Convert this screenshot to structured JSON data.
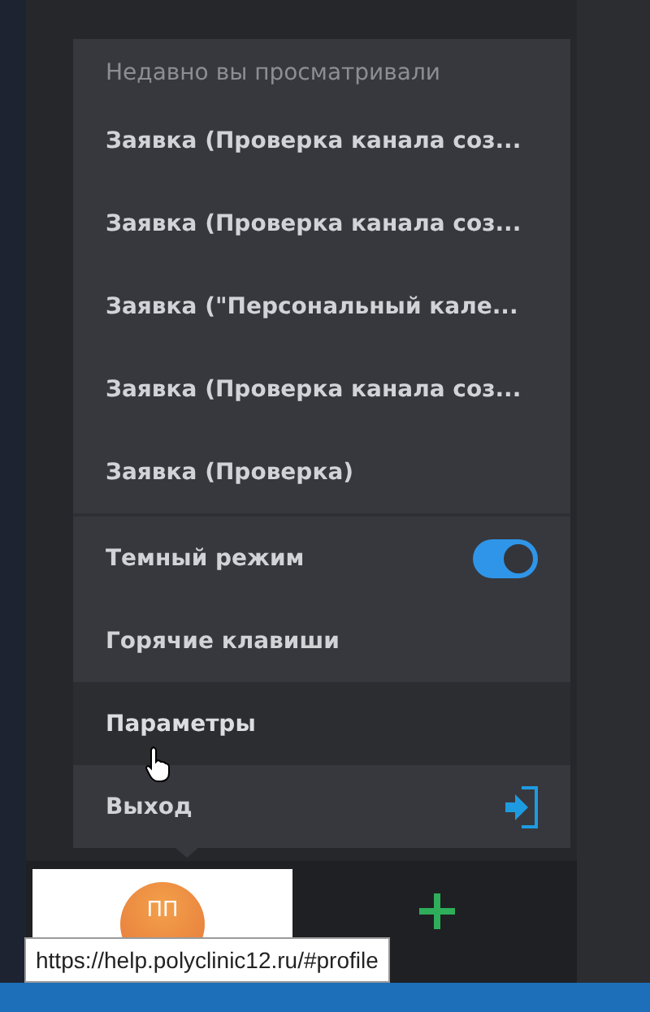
{
  "menu": {
    "heading": "Недавно вы просматривали",
    "recent": [
      {
        "title": "Заявка (Проверка канала соз..."
      },
      {
        "title": "Заявка (Проверка канала соз..."
      },
      {
        "title": "Заявка (\"Персональный кале..."
      },
      {
        "title": "Заявка (Проверка канала соз..."
      },
      {
        "title": "Заявка (Проверка)"
      }
    ],
    "items": [
      {
        "kind": "toggle",
        "label": "Темный режим",
        "on": true,
        "hovered": false
      },
      {
        "kind": "link",
        "label": "Горячие клавиши",
        "hovered": false
      },
      {
        "kind": "link",
        "label": "Параметры",
        "hovered": true
      },
      {
        "kind": "exit",
        "label": "Выход",
        "hovered": false
      }
    ]
  },
  "profile": {
    "initials": "ПП"
  },
  "tooltip": {
    "text": "https://help.polyclinic12.ru/#profile"
  }
}
